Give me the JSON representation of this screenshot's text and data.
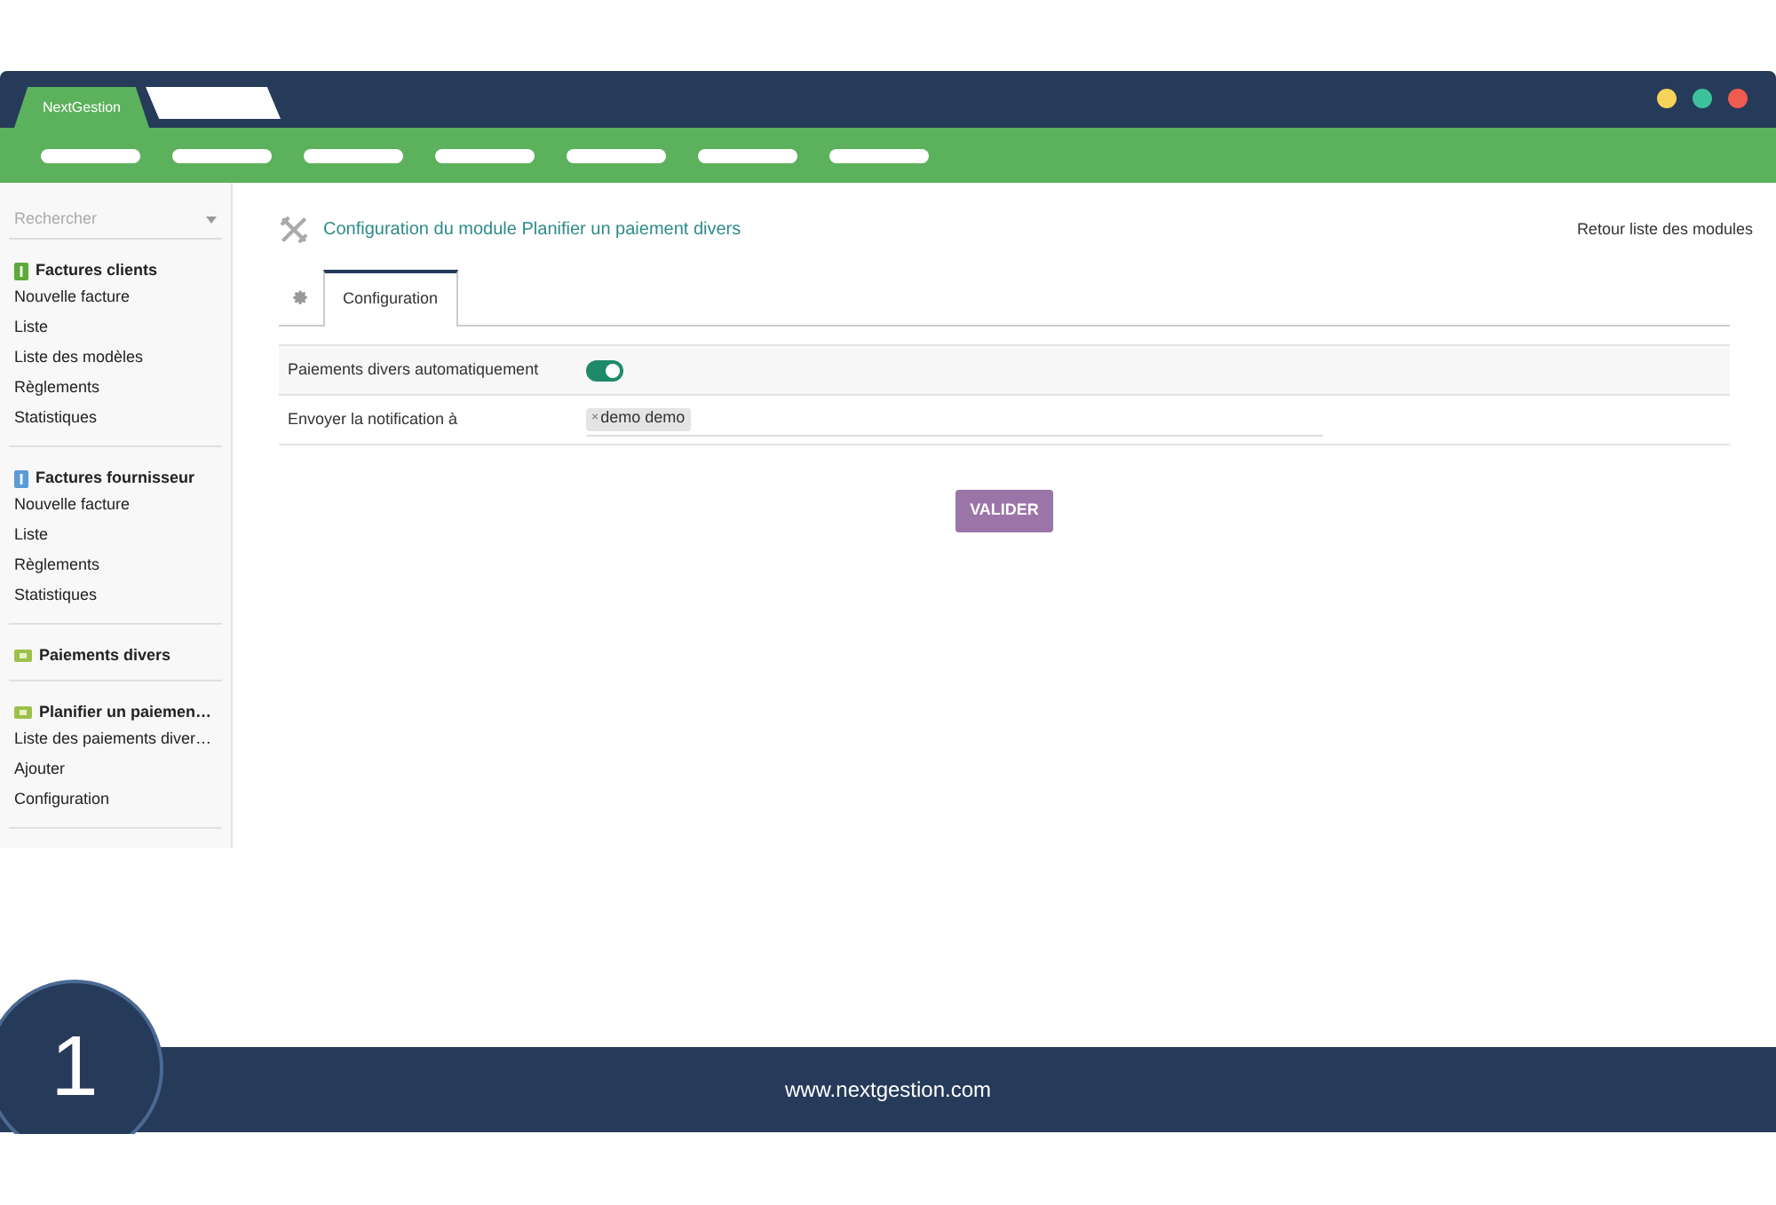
{
  "app": {
    "brand": "NextGestion"
  },
  "sidebar": {
    "search": {
      "placeholder": "Rechercher"
    },
    "sections": [
      {
        "title": "Factures clients",
        "kind": "invoice",
        "color": "#5fa83a",
        "items": [
          "Nouvelle facture",
          "Liste",
          "Liste des modèles",
          "Règlements",
          "Statistiques"
        ]
      },
      {
        "title": "Factures fournisseur",
        "kind": "invoice",
        "color": "#5b9bd5",
        "items": [
          "Nouvelle facture",
          "Liste",
          "Règlements",
          "Statistiques"
        ]
      },
      {
        "title": "Paiements divers",
        "kind": "banknote",
        "color": "#9cc14a"
      },
      {
        "title": "Planifier un paiemen…",
        "kind": "banknote",
        "color": "#9cc14a",
        "items": [
          "Liste des paiements diver…",
          "Ajouter",
          "Configuration"
        ]
      }
    ]
  },
  "page": {
    "title": "Configuration du module Planifier un paiement divers",
    "back_link": "Retour liste des modules",
    "tabs": [
      {
        "label": "Configuration",
        "selected": true
      }
    ],
    "fields": [
      {
        "kind": "toggle",
        "label": "Paiements divers automatiquement",
        "on": true
      },
      {
        "kind": "tags",
        "label": "Envoyer la notification à",
        "tags": [
          {
            "remove": "×",
            "label": "demo demo"
          }
        ]
      }
    ],
    "submit": "VALIDER"
  },
  "footer": {
    "step": "1",
    "website": "www.nextgestion.com"
  }
}
